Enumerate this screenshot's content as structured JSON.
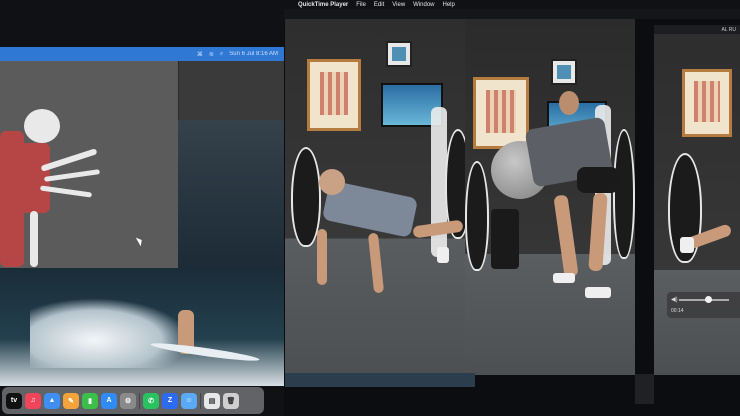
{
  "menubar": {
    "apple": "",
    "app_name": "QuickTime Player",
    "items": [
      "File",
      "Edit",
      "View",
      "Window",
      "Help"
    ]
  },
  "left_menubar": {
    "date_time": "Sun 6 Jul  8:16 AM"
  },
  "third_window": {
    "title": "AL RU",
    "time": "00:14"
  },
  "dock": {
    "apps": [
      "tv",
      "music",
      "keynote",
      "pages",
      "numbers",
      "app-store",
      "system-settings",
      "whatsapp",
      "zoom",
      "finder",
      "preview",
      "trash"
    ],
    "tv_label": "tv"
  },
  "colors": {
    "left_menubar_blue": "#2f78d3",
    "poster_frame": "#b67b3f",
    "floor_gray": "#5b5e61"
  }
}
